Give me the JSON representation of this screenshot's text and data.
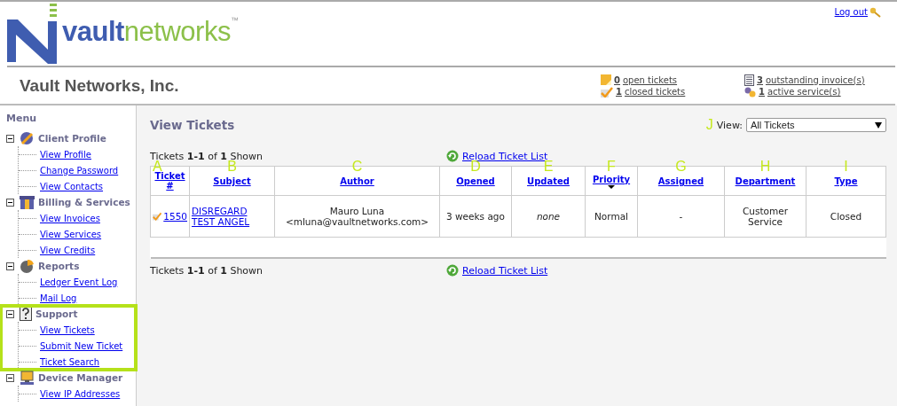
{
  "logo": {
    "word_1": "vault",
    "word_2": "networks",
    "trademark": "™"
  },
  "logout": {
    "label": "Log out"
  },
  "company": "Vault Networks, Inc.",
  "summary": [
    {
      "kind": "open",
      "count": "0",
      "label": "open tickets"
    },
    {
      "kind": "invoice",
      "count": "3",
      "label": "outstanding invoice(s)"
    },
    {
      "kind": "closed",
      "count": "1",
      "label": "closed tickets"
    },
    {
      "kind": "service",
      "count": "1",
      "label": "active service(s)"
    }
  ],
  "menu": {
    "title": "Menu",
    "groups": [
      {
        "label": "Client Profile",
        "kind": "profile",
        "expanded": true,
        "highlighted": false,
        "children": [
          {
            "label": "View Profile"
          },
          {
            "label": "Change Password"
          },
          {
            "label": "View Contacts"
          }
        ]
      },
      {
        "label": "Billing & Services",
        "kind": "billing",
        "expanded": true,
        "highlighted": false,
        "children": [
          {
            "label": "View Invoices"
          },
          {
            "label": "View Services"
          },
          {
            "label": "View Credits"
          }
        ]
      },
      {
        "label": "Reports",
        "kind": "reports",
        "expanded": true,
        "highlighted": false,
        "children": [
          {
            "label": "Ledger Event Log"
          },
          {
            "label": "Mail Log"
          }
        ]
      },
      {
        "label": "Support",
        "kind": "support",
        "expanded": true,
        "highlighted": true,
        "children": [
          {
            "label": "View Tickets"
          },
          {
            "label": "Submit New Ticket"
          },
          {
            "label": "Ticket Search"
          }
        ]
      },
      {
        "label": "Device Manager",
        "kind": "device",
        "expanded": true,
        "highlighted": false,
        "children": [
          {
            "label": "View IP Addresses"
          }
        ]
      }
    ]
  },
  "main": {
    "title": "View Tickets",
    "view": {
      "callout": "J",
      "label": "View:",
      "value": "All Tickets"
    },
    "shown_top": "Tickets **1-1** of **1** Shown",
    "reload_top": "Reload Ticket List",
    "columns": [
      {
        "callout": "A",
        "label": "Ticket #",
        "sorted": false
      },
      {
        "callout": "B",
        "label": "Subject",
        "sorted": false
      },
      {
        "callout": "C",
        "label": "Author",
        "sorted": false
      },
      {
        "callout": "D",
        "label": "Opened",
        "sorted": false
      },
      {
        "callout": "E",
        "label": "Updated",
        "sorted": false
      },
      {
        "callout": "F",
        "label": "Priority",
        "sorted": true
      },
      {
        "callout": "G",
        "label": "Assigned",
        "sorted": false
      },
      {
        "callout": "H",
        "label": "Department",
        "sorted": false
      },
      {
        "callout": "I",
        "label": "Type",
        "sorted": false
      }
    ],
    "rows": [
      {
        "closed": true,
        "cells": [
          {
            "kind": "link",
            "text": "1550"
          },
          {
            "kind": "link",
            "text": "DISREGARD TEST ANGEL"
          },
          {
            "kind": "text",
            "text": "Mauro Luna <mluna@vaultnetworks.com>"
          },
          {
            "kind": "text",
            "text": "3 weeks ago"
          },
          {
            "kind": "muted",
            "text": "none"
          },
          {
            "kind": "text",
            "text": "Normal"
          },
          {
            "kind": "text",
            "text": "-"
          },
          {
            "kind": "text",
            "text": "Customer Service"
          },
          {
            "kind": "text",
            "text": "Closed"
          }
        ]
      }
    ],
    "shown_bottom": "Tickets **1-1** of **1** Shown",
    "reload_bottom": "Reload Ticket List"
  }
}
